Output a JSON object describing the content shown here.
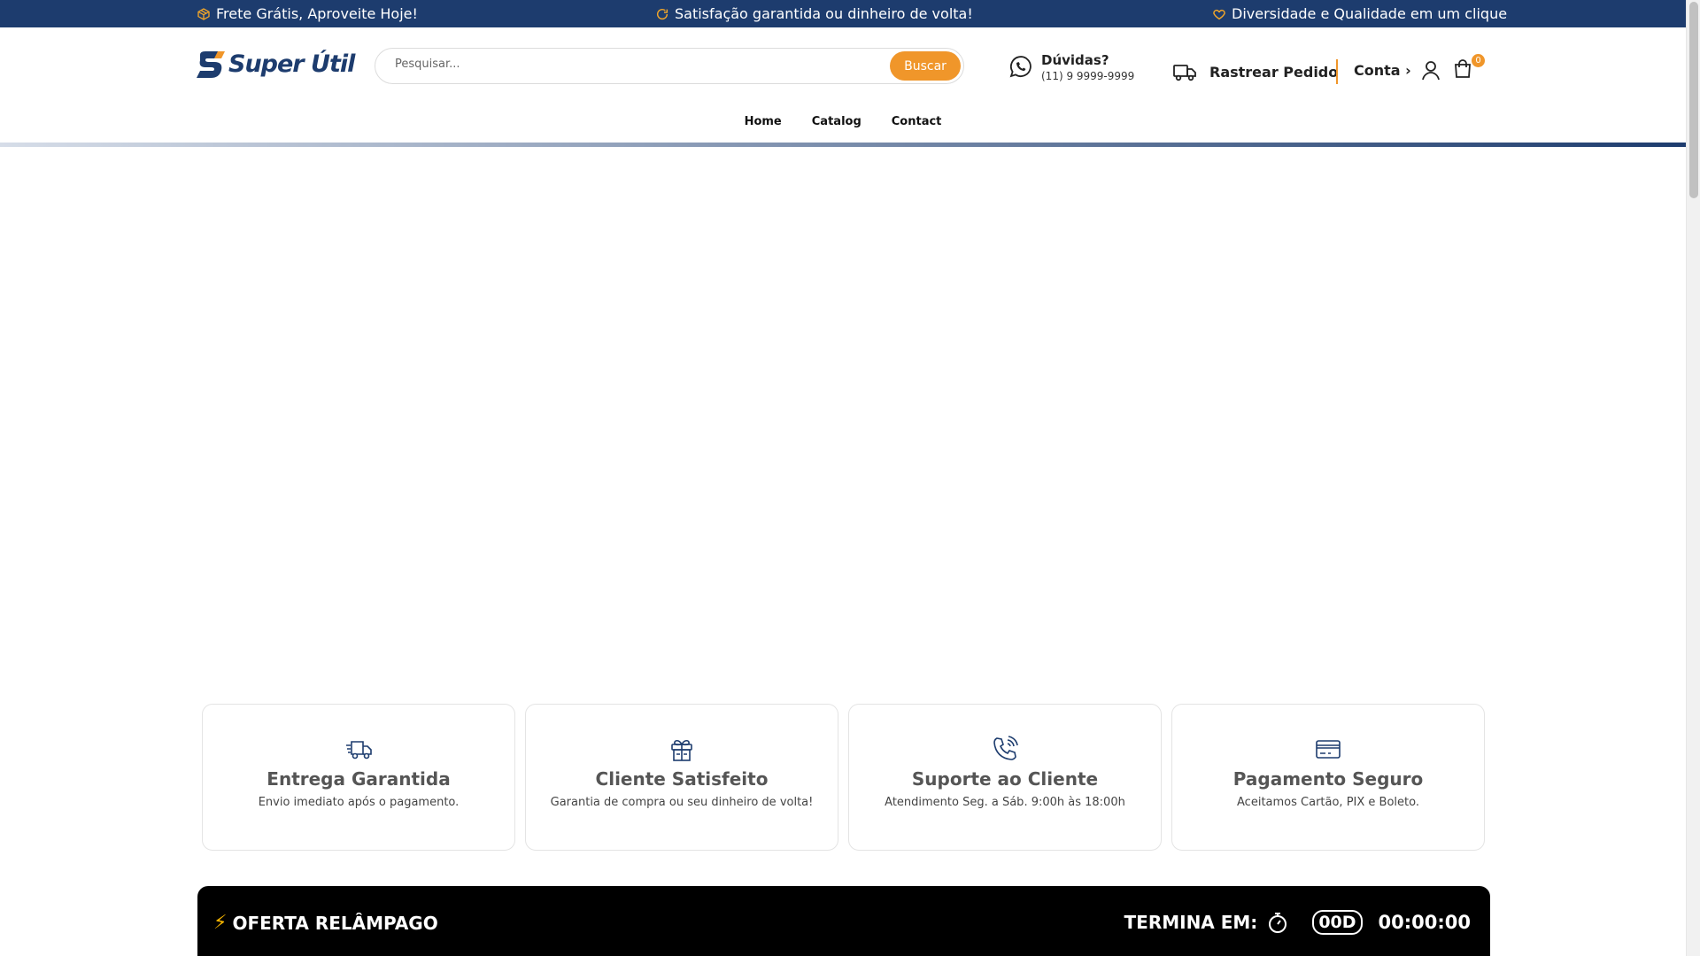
{
  "topbar": {
    "msg1": "Frete Grátis, Aproveite Hoje!",
    "msg2": "Satisfação garantida ou dinheiro de volta!",
    "msg3": "Diversidade e Qualidade em um clique"
  },
  "logo": {
    "name_a": "Super",
    "name_b": "Útil"
  },
  "search": {
    "placeholder": "Pesquisar...",
    "button": "Buscar"
  },
  "help": {
    "title": "Dúvidas?",
    "phone": "(11) 9 9999-9999"
  },
  "track": {
    "label": "Rastrear Pedido"
  },
  "account": {
    "label": "Conta ›"
  },
  "cart": {
    "count": "0"
  },
  "nav": [
    "Home",
    "Catalog",
    "Contact"
  ],
  "features": [
    {
      "title": "Entrega Garantida",
      "desc": "Envio imediato após o pagamento.",
      "icon": "fast-delivery-icon"
    },
    {
      "title": "Cliente Satisfeito",
      "desc": "Garantia de compra ou seu dinheiro de volta!",
      "icon": "gift-box-icon"
    },
    {
      "title": "Suporte ao Cliente",
      "desc": "Atendimento Seg. a Sáb. 9:00h às 18:00h",
      "icon": "phone-call-icon"
    },
    {
      "title": "Pagamento Seguro",
      "desc": "Aceitamos Cartão, PIX e Boleto.",
      "icon": "credit-card-icon"
    }
  ],
  "flash": {
    "title": "OFERTA RELÂMPAGO",
    "ends_label": "TERMINA EM:",
    "days": "00D",
    "time": "00:00:00"
  },
  "colors": {
    "brand": "#1d3c6e",
    "accent": "#f0962a"
  }
}
